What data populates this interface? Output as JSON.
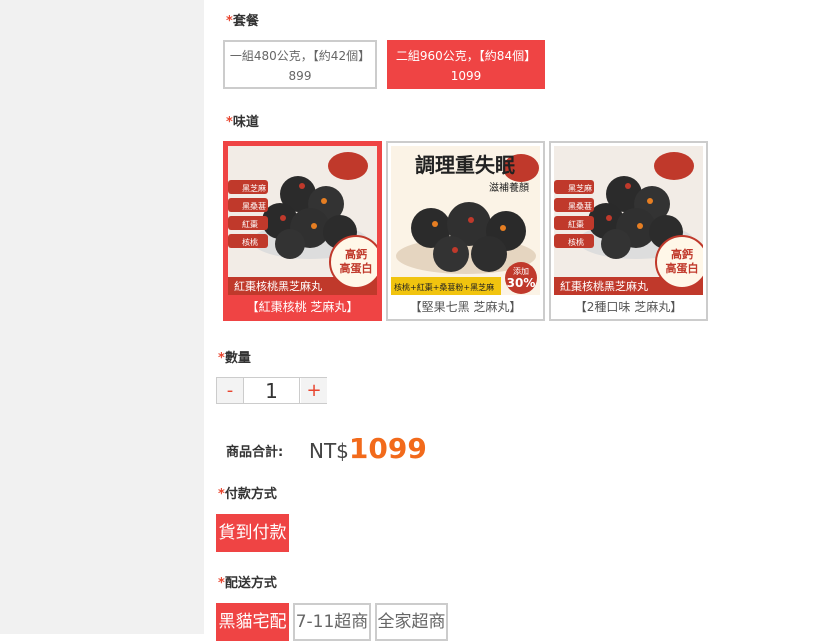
{
  "package": {
    "label": "套餐",
    "options": [
      {
        "line1": "一組480公克，【約42個】",
        "line2": "899"
      },
      {
        "line1": "二組960公克，【約84個】",
        "line2": "1099"
      }
    ]
  },
  "flavor": {
    "label": "味道",
    "options": [
      {
        "caption": "【紅棗核桃 芝麻丸】",
        "img_title": "紅棗核桃黑芝麻丸",
        "tags": [
          "黑芝麻",
          "黑桑葚",
          "紅棗",
          "核桃"
        ],
        "badge": "高鈣\n高蛋白"
      },
      {
        "caption": "【堅果七黑 芝麻丸】",
        "img_title": "調理重失眠",
        "img_sub": "滋補養顏",
        "img_bar": "核桃+紅棗+桑葚粉+黑芝麻",
        "badge_top": "添加",
        "badge_num": "30%"
      },
      {
        "caption": "【2種口味 芝麻丸】",
        "img_title": "紅棗核桃黑芝麻丸",
        "tags": [
          "黑芝麻",
          "黑桑葚",
          "紅棗",
          "核桃"
        ],
        "badge": "高鈣\n高蛋白"
      }
    ]
  },
  "quantity": {
    "label": "數量",
    "minus": "-",
    "plus": "+",
    "value": "1"
  },
  "total": {
    "label": "商品合計:",
    "currency": "NT$",
    "amount": "1099"
  },
  "payment": {
    "label": "付款方式",
    "options": [
      "貨到付款"
    ]
  },
  "shipping": {
    "label": "配送方式",
    "options": [
      "黑貓宅配",
      "7-11超商",
      "全家超商"
    ]
  },
  "required_mark": "*",
  "colors": {
    "accent": "#ef4444",
    "price": "#f26a1b"
  }
}
